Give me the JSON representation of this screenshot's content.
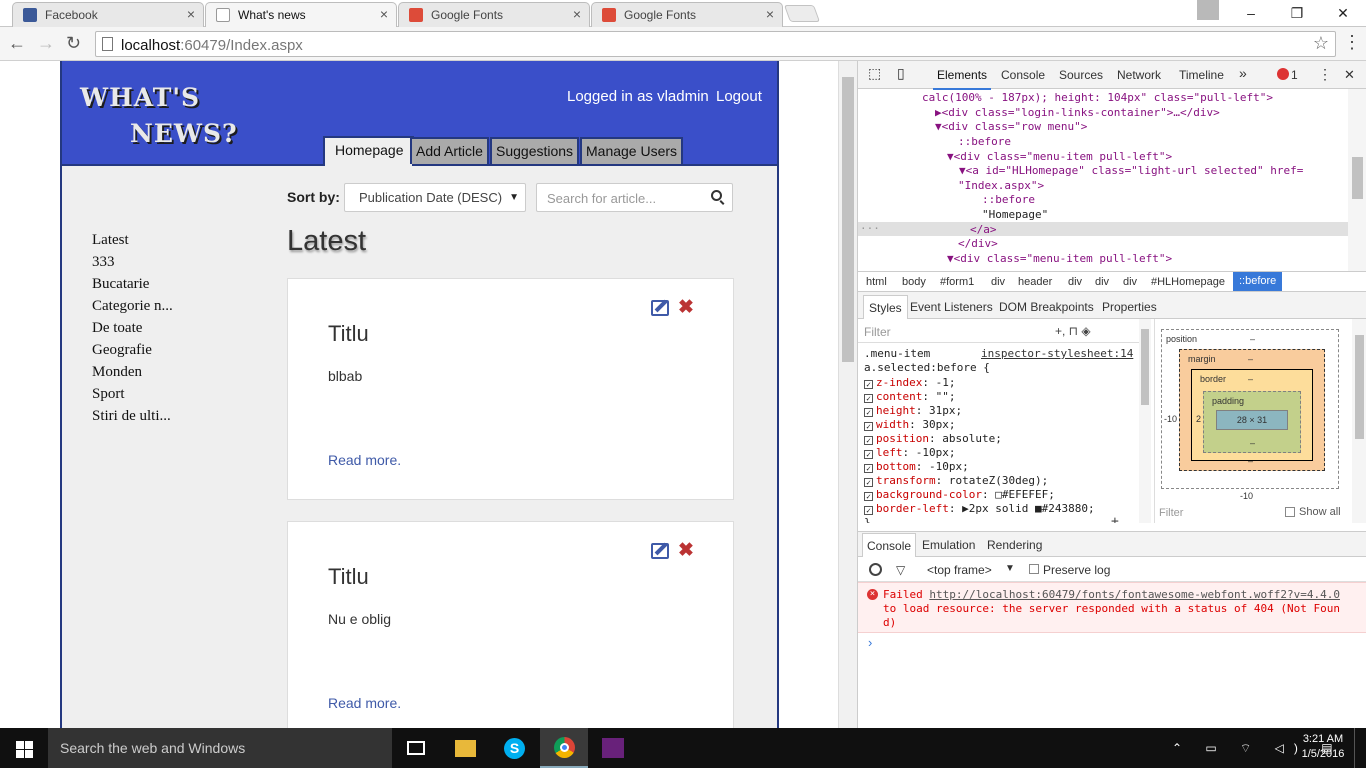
{
  "tabs": [
    {
      "title": "Facebook",
      "close": "×"
    },
    {
      "title": "What's news",
      "close": "×"
    },
    {
      "title": "Google Fonts",
      "close": "×"
    },
    {
      "title": "Google Fonts",
      "close": "×"
    }
  ],
  "window": {
    "minimize": "–",
    "maximize": "❐",
    "close": "✕"
  },
  "toolbar": {
    "back": "←",
    "forward": "→",
    "reload": "↻",
    "url_host": "localhost",
    "url_path": ":60479/Index.aspx",
    "star": "☆",
    "menu": "⋮"
  },
  "site": {
    "logo_line1": "WHAT'S",
    "logo_line2": "NEWS?",
    "login_text": "Logged in as vladmin",
    "logout": "Logout",
    "menu": [
      "Homepage",
      "Add Article",
      "Suggestions",
      "Manage Users"
    ],
    "sort_label": "Sort by:",
    "sort_value": "Publication Date (DESC)",
    "sort_caret": "▼",
    "search_placeholder": "Search for article...",
    "categories": [
      "Latest",
      "333",
      "Bucatarie",
      "Categorie n...",
      "De toate",
      "Geografie",
      "Monden",
      "Sport",
      "Stiri de ulti..."
    ],
    "heading": "Latest",
    "articles": [
      {
        "title": "Titlu",
        "body": "blbab",
        "more": "Read more.",
        "delete": "✖"
      },
      {
        "title": "Titlu",
        "body": "Nu e oblig",
        "more": "Read more.",
        "delete": "✖"
      }
    ]
  },
  "devtools": {
    "inspect": "⬚",
    "device": "▯",
    "tabs": [
      "Elements",
      "Console",
      "Sources",
      "Network",
      "Timeline"
    ],
    "more": "»",
    "errors": "1",
    "kebab": "⋮",
    "close": "✕",
    "dom_lines": [
      "calc(100% - 187px); height: 104px\" class=\"pull-left\">",
      "▶<div class=\"login-links-container\">…</div>",
      "▼<div class=\"row menu\">",
      "::before",
      "▼<div class=\"menu-item pull-left\">",
      "▼<a id=\"HLHomepage\" class=\"light-url selected\" href=",
      "\"Index.aspx\">",
      "::before",
      "\"Homepage\"",
      "</a>",
      "</div>",
      "▼<div class=\"menu-item pull-left\">"
    ],
    "dom_ellipsis": "···",
    "breadcrumbs": [
      "html",
      "body",
      "#form1",
      "div",
      "header",
      "div",
      "div",
      "div",
      "#HLHomepage",
      "::before"
    ],
    "styles_tabs": [
      "Styles",
      "Event Listeners",
      "DOM Breakpoints",
      "Properties"
    ],
    "filter_placeholder": "Filter",
    "filter_tools": "+, ⊓ ◈",
    "rule_selector_1": ".menu-item",
    "rule_selector_2": "a.selected:before {",
    "rule_source": "inspector-stylesheet:14",
    "rule_props": [
      {
        "name": "z-index",
        "value": "-1;"
      },
      {
        "name": "content",
        "value": "\"\";"
      },
      {
        "name": "height",
        "value": "31px;"
      },
      {
        "name": "width",
        "value": "30px;"
      },
      {
        "name": "position",
        "value": "absolute;"
      },
      {
        "name": "left",
        "value": "-10px;"
      },
      {
        "name": "bottom",
        "value": "-10px;"
      },
      {
        "name": "transform",
        "value": "rotateZ(30deg);"
      },
      {
        "name": "background-color",
        "value": "□#EFEFEF;"
      },
      {
        "name": "border-left",
        "value": "▶2px solid ■#243880;"
      }
    ],
    "rule_close": "}",
    "rule_add": "+",
    "box_model": {
      "position_label": "position",
      "position_val": "–",
      "margin_label": "margin",
      "margin_val": "–",
      "border_label": "border",
      "border_val": "–",
      "padding_label": "padding",
      "padding_val": "–",
      "content": "28 × 31",
      "left_out": "-10",
      "left_bor": "2",
      "bottom_out": "-10",
      "dash": "–"
    },
    "bm_filter": "Filter",
    "show_all": "Show all",
    "console_tabs": [
      "Console",
      "Emulation",
      "Rendering"
    ],
    "console_frame": "<top frame>",
    "console_frame_caret": "▼",
    "preserve_log": "Preserve log",
    "error_link": "http://localhost:60479/fonts/fontawesome-webfont.woff2?v=4.4.0",
    "error_pre": "Failed ",
    "error_post": " to load resource: the server responded with a status of 404 (Not Found)",
    "prompt": "›"
  },
  "taskbar": {
    "search": "Search the web and Windows",
    "tray": "⌃ ▭ ⌔ ◁) ▤",
    "time": "3:21 AM",
    "date": "1/5/2016"
  }
}
